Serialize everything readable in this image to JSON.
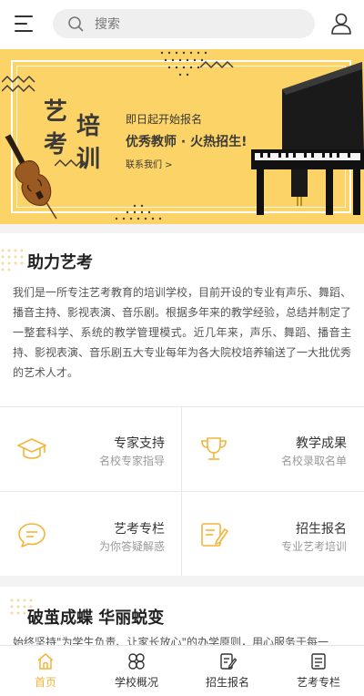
{
  "header": {
    "search_placeholder": "搜索",
    "menu_icon": "menu-icon",
    "user_icon": "user-icon"
  },
  "banner": {
    "title_chars": [
      "艺",
      "考",
      "培",
      "训"
    ],
    "line1": "即日起开始报名",
    "line2": "优秀教师 · 火热招生!",
    "line3": "联系我们 >",
    "slides": 2,
    "active_slide": 0,
    "bg_color": "#fcd366"
  },
  "about": {
    "title": "助力艺考",
    "text": "我们是一所专注艺考教育的培训学校，目前开设的专业有声乐、舞蹈、播音主持、影视表演、音乐剧。根据多年来的教学经验，总结并制定了一整套科学、系统的教学管理模式。近几年来，声乐、舞蹈、播音主持、影视表演、音乐剧五大专业每年为各大院校培养输送了一大批优秀的艺术人才。"
  },
  "features": [
    {
      "title": "专家支持",
      "subtitle": "名校专家指导",
      "icon": "graduation-cap-icon"
    },
    {
      "title": "教学成果",
      "subtitle": "名校录取名单",
      "icon": "trophy-icon"
    },
    {
      "title": "艺考专栏",
      "subtitle": "为你答疑解惑",
      "icon": "chat-bubble-icon"
    },
    {
      "title": "招生报名",
      "subtitle": "专业艺考培训",
      "icon": "edit-form-icon"
    }
  ],
  "section2": {
    "title": "破茧成蝶  华丽蜕变",
    "text": "始终坚持\"为学生负责、让家长放心\"的办学原则，用心服务于每一"
  },
  "tabbar": {
    "active": 0,
    "accent_color": "#f3b43a",
    "items": [
      {
        "label": "首页",
        "icon": "home-icon"
      },
      {
        "label": "学校概况",
        "icon": "grid-petals-icon"
      },
      {
        "label": "招生报名",
        "icon": "edit-form-icon"
      },
      {
        "label": "艺考专栏",
        "icon": "document-icon"
      }
    ]
  }
}
